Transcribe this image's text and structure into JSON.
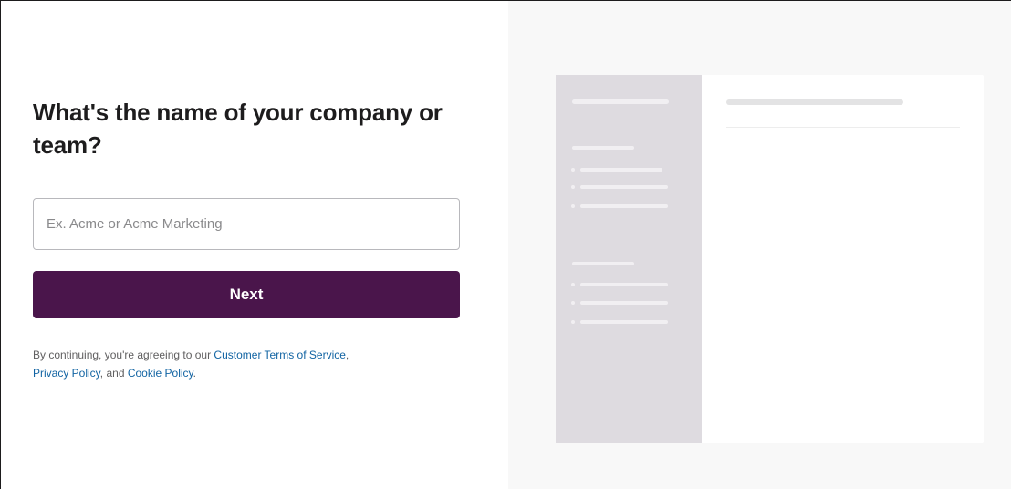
{
  "form": {
    "heading": "What's the name of your company or team?",
    "input_placeholder": "Ex. Acme or Acme Marketing",
    "input_value": "",
    "next_label": "Next"
  },
  "legal": {
    "prefix": "By continuing, you're agreeing to our ",
    "terms_link": "Customer Terms of Service",
    "sep1": ",",
    "privacy_link": "Privacy Policy",
    "sep2": ", and ",
    "cookie_link": "Cookie Policy",
    "suffix": "."
  },
  "colors": {
    "brand_aubergine": "#4a154b",
    "link_blue": "#1264a3",
    "preview_sidebar": "#dedbe0",
    "preview_bg": "#f8f8f8"
  }
}
